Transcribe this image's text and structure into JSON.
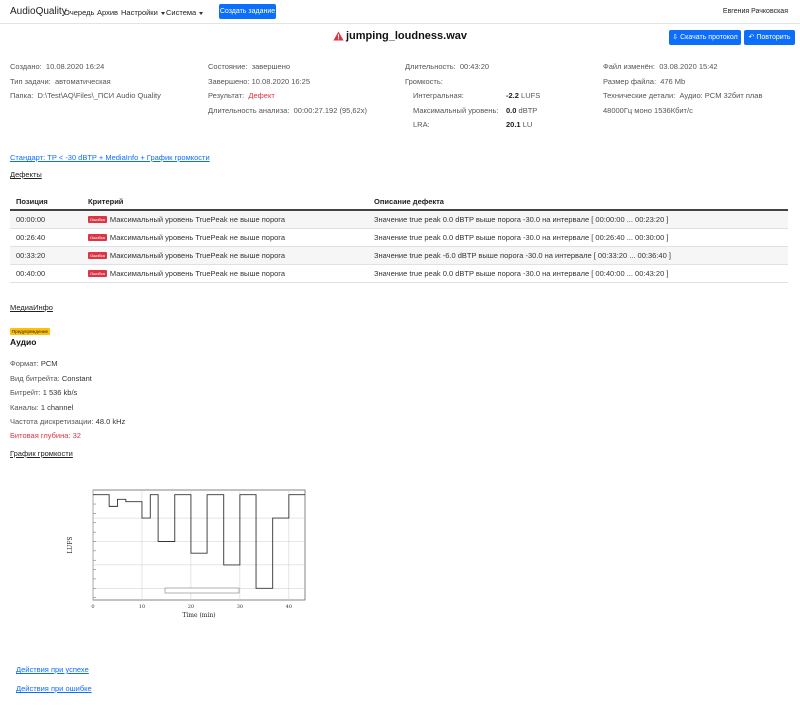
{
  "navbar": {
    "brand": "AudioQuality",
    "items": [
      "Очередь",
      "Архив",
      "Настройки",
      "Система"
    ],
    "create_button": "Создать задание",
    "user": "Евгения Рачковская"
  },
  "header": {
    "title": "jumping_loudness.wav",
    "download_button": "Скачать протокол",
    "repeat_button": "Повторить"
  },
  "info": {
    "created_label": "Создано:",
    "created": "10.08.2020 16:24",
    "task_type_label": "Тип задачи:",
    "task_type": "автоматическая",
    "folder_label": "Папка:",
    "folder": "D:\\Test\\AQ\\Files\\_ПСИ Audio Quality",
    "state_label": "Состояние:",
    "state": "завершено",
    "finished_label": "Завершено:",
    "finished": "10.08.2020 16:25",
    "result_label": "Результат:",
    "result": "Дефект",
    "analysis_label": "Длительность анализа:",
    "analysis": "00:00:27.192  (95,62x)",
    "duration_label": "Длительность:",
    "duration": "00:43:20",
    "loudness_label": "Громкость:",
    "integral_label": "Интегральная:",
    "integral_value": "-2.2",
    "integral_unit": "LUFS",
    "maxlevel_label": "Максимальный уровень:",
    "maxlevel_value": "0.0",
    "maxlevel_unit": "dBTP",
    "lra_label": "LRA:",
    "lra_value": "20.1",
    "lra_unit": "LU",
    "modified_label": "Файл изменён:",
    "modified": "03.08.2020 15:42",
    "size_label": "Размер файла:",
    "size": "476 Mb",
    "tech_label": "Технические детали:",
    "tech": "Аудио: PCM 32бит плав",
    "tech2": "48000Гц моно 1536Кбит/с"
  },
  "standard_link": "Стандарт: TP < -30 dBTP + MediaInfo + График громкости",
  "defects_heading": "Дефекты",
  "table": {
    "headers": [
      "Позиция",
      "Критерий",
      "Описание дефекта"
    ],
    "badge": "Ошибка",
    "rows": [
      {
        "pos": "00:00:00",
        "crit": "Максимальный уровень TruePeak не выше порога",
        "desc": "Значение true peak 0.0 dBTP выше порога -30.0 на интервале [ 00:00:00 ... 00:23:20 ]"
      },
      {
        "pos": "00:26:40",
        "crit": "Максимальный уровень TruePeak не выше порога",
        "desc": "Значение true peak 0.0 dBTP выше порога -30.0 на интервале [ 00:26:40 ... 00:30:00 ]"
      },
      {
        "pos": "00:33:20",
        "crit": "Максимальный уровень TruePeak не выше порога",
        "desc": "Значение true peak -6.0 dBTP выше порога -30.0 на интервале [ 00:33:20 ... 00:36:40 ]"
      },
      {
        "pos": "00:40:00",
        "crit": "Максимальный уровень TruePeak не выше порога",
        "desc": "Значение true peak 0.0 dBTP выше порога -30.0 на интервале [ 00:40:00 ... 00:43:20 ]"
      }
    ]
  },
  "mediainfo": {
    "heading": "МедиаИнфо",
    "badge": "Предупреждение",
    "title": "Аудио",
    "rows": [
      {
        "label": "Формат:",
        "value": "PCM"
      },
      {
        "label": "Вид битрейта:",
        "value": "Constant"
      },
      {
        "label": "Битрейт:",
        "value": "1 536 kb/s"
      },
      {
        "label": "Каналы:",
        "value": "1 channel"
      },
      {
        "label": "Частота дискретизации:",
        "value": "48.0 kHz"
      },
      {
        "label": "Битовая глубина:",
        "value": "32"
      }
    ]
  },
  "loudness_graph_heading": "График громкости",
  "chart_data": {
    "type": "line",
    "xlabel": "Time (min)",
    "ylabel": "LUFS",
    "x_ticks": [
      0,
      10,
      20,
      30,
      40
    ],
    "xlim": [
      0,
      43.3
    ],
    "grid": true,
    "series": [
      {
        "x": [
          0,
          3.3,
          3.3,
          5,
          5,
          6.7,
          6.7,
          10,
          10,
          11.7,
          11.7,
          13.3,
          13.3,
          16.7,
          16.7,
          20,
          20,
          23.3,
          23.3,
          26.7,
          26.7,
          30,
          30,
          33.3,
          33.3,
          36.7,
          36.7,
          40,
          40,
          43.3
        ],
        "y": [
          0,
          0,
          -5,
          -5,
          -2,
          -2,
          -3,
          -3,
          -10,
          -10,
          0,
          0,
          -20,
          -20,
          0,
          0,
          -25,
          -25,
          0,
          0,
          -30,
          -30,
          0,
          0,
          -40,
          -40,
          -10,
          -10,
          0,
          0
        ]
      }
    ]
  },
  "actions": {
    "success": "Действия при успехе",
    "error": "Действия при ошибке"
  }
}
